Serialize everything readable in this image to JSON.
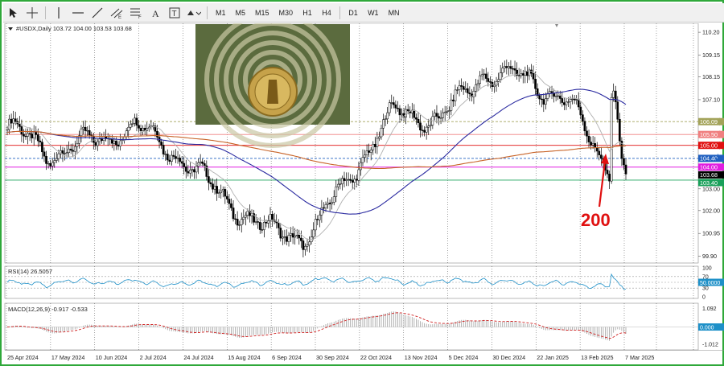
{
  "toolbar": {
    "tools": [
      {
        "name": "cursor-tool-icon"
      },
      {
        "name": "crosshair-tool-icon"
      },
      {
        "name": "vertical-line-tool-icon"
      },
      {
        "name": "horizontal-line-tool-icon"
      },
      {
        "name": "trendline-tool-icon"
      },
      {
        "name": "equidistant-channel-tool-icon"
      },
      {
        "name": "fibonacci-tool-icon"
      },
      {
        "name": "text-tool-icon"
      },
      {
        "name": "text-label-tool-icon"
      },
      {
        "name": "shapes-tool-icon"
      }
    ],
    "timeframes": [
      "M1",
      "M5",
      "M15",
      "M30",
      "H1",
      "H4",
      "D1",
      "W1",
      "MN"
    ]
  },
  "chart_data": {
    "type": "candlestick",
    "header": "#USDX,Daily  103.72 104.00 103.53 103.68",
    "y_axis_ticks": [
      {
        "label": "110.20",
        "value": 110.2
      },
      {
        "label": "109.15",
        "value": 109.15
      },
      {
        "label": "108.15",
        "value": 108.15
      },
      {
        "label": "107.10",
        "value": 107.1
      },
      {
        "label": "103.00",
        "value": 103.0
      },
      {
        "label": "102.00",
        "value": 102.0
      },
      {
        "label": "100.95",
        "value": 100.95
      },
      {
        "label": "99.90",
        "value": 99.9
      }
    ],
    "ylim": [
      99.7,
      110.5
    ],
    "x_axis_labels": [
      "25 Apr 2024",
      "17 May 2024",
      "10 Jun 2024",
      "2 Jul 2024",
      "24 Jul 2024",
      "15 Aug 2024",
      "6 Sep 2024",
      "30 Sep 2024",
      "22 Oct 2024",
      "13 Nov 2024",
      "5 Dec 2024",
      "30 Dec 2024",
      "22 Jan 2025",
      "13 Feb 2025",
      "7 Mar 2025"
    ],
    "level_labels": [
      {
        "label": "106.09",
        "value": 106.09,
        "color": "#a3a35a",
        "arrow": true
      },
      {
        "label": "105.50",
        "value": 105.5,
        "color": "#f08080",
        "arrow": true
      },
      {
        "label": "105.00",
        "value": 105.0,
        "color": "#e01010",
        "arrow": true
      },
      {
        "label": "104.40",
        "value": 104.4,
        "color": "#2060c0",
        "arrow": true
      },
      {
        "label": "104.00",
        "value": 104.0,
        "color": "#e01ee0",
        "arrow": false
      },
      {
        "label": "103.68",
        "value": 103.68,
        "color": "#000000",
        "arrow": false
      },
      {
        "label": "103.40",
        "value": 103.4,
        "color": "#1aa05a",
        "arrow": false
      }
    ],
    "annotation": {
      "text": "200"
    },
    "ma_colors": {
      "fast": "#b0b0b0",
      "mid": "#2a2aa0",
      "slow": "#c86428"
    },
    "price_path": [
      {
        "d": "25 Apr 2024",
        "c": 105.9
      },
      {
        "d": "17 May 2024",
        "c": 104.6
      },
      {
        "d": "10 Jun 2024",
        "c": 105.2
      },
      {
        "d": "2 Jul 2024",
        "c": 105.9
      },
      {
        "d": "24 Jul 2024",
        "c": 104.5
      },
      {
        "d": "15 Aug 2024",
        "c": 102.6
      },
      {
        "d": "6 Sep 2024",
        "c": 101.1
      },
      {
        "d": "30 Sep 2024",
        "c": 100.8
      },
      {
        "d": "22 Oct 2024",
        "c": 103.8
      },
      {
        "d": "13 Nov 2024",
        "c": 106.6
      },
      {
        "d": "5 Dec 2024",
        "c": 106.1
      },
      {
        "d": "30 Dec 2024",
        "c": 108.3
      },
      {
        "d": "22 Jan 2025",
        "c": 108.1
      },
      {
        "d": "13 Feb 2025",
        "c": 107.0
      },
      {
        "d": "7 Mar 2025",
        "c": 103.68
      }
    ],
    "rsi": {
      "label": "RSI(14) 26.5057",
      "levels": [
        {
          "label": "100",
          "value": 100
        },
        {
          "label": "70",
          "value": 70
        },
        {
          "label": "50.0000",
          "value": 50
        },
        {
          "label": "30",
          "value": 30
        },
        {
          "label": "0",
          "value": 0
        }
      ],
      "color": "#1e90c8"
    },
    "macd": {
      "label": "MACD(12,26,9) -0.917 -0.533",
      "levels": [
        {
          "label": "1.092",
          "value": 1.092
        },
        {
          "label": "0.000",
          "value": 0
        },
        {
          "label": "-1.012",
          "value": -1.012
        }
      ],
      "signal_color": "#d02020"
    }
  }
}
